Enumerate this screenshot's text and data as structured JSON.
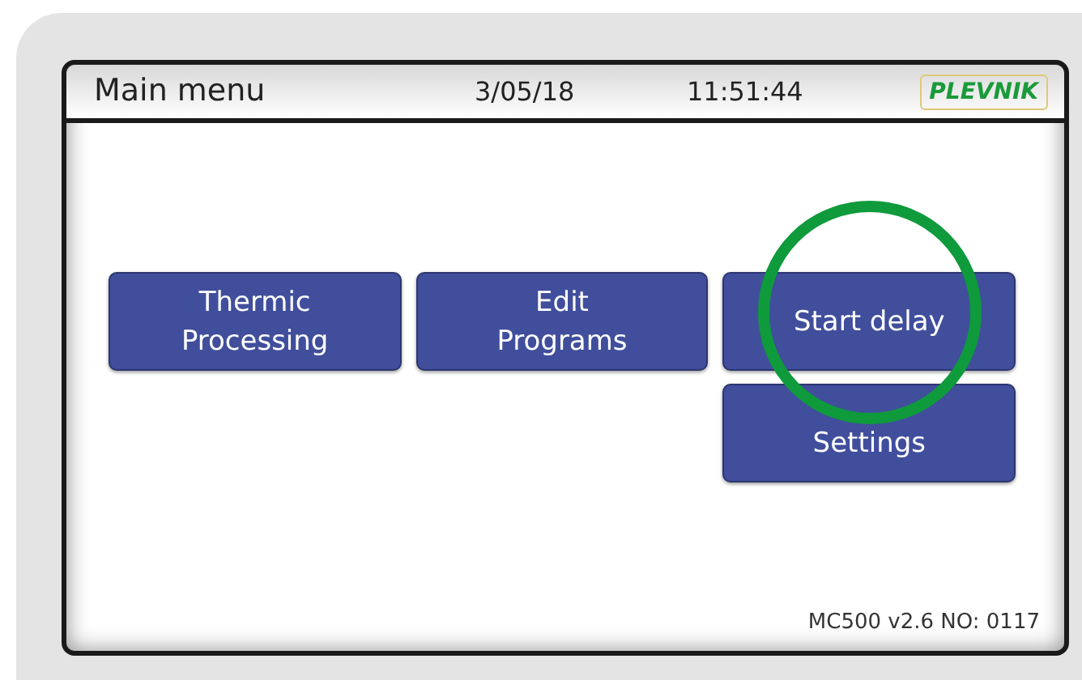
{
  "header": {
    "title": "Main menu",
    "date": "3/05/18",
    "time": "11:51:44",
    "logo": "PLEVNIK"
  },
  "buttons": [
    {
      "label": "Thermic\nProcessing"
    },
    {
      "label": "Edit\nPrograms"
    },
    {
      "label": "Start delay"
    },
    {
      "label": "Settings"
    }
  ],
  "footer": "MC500 v2.6 NO: 0117"
}
